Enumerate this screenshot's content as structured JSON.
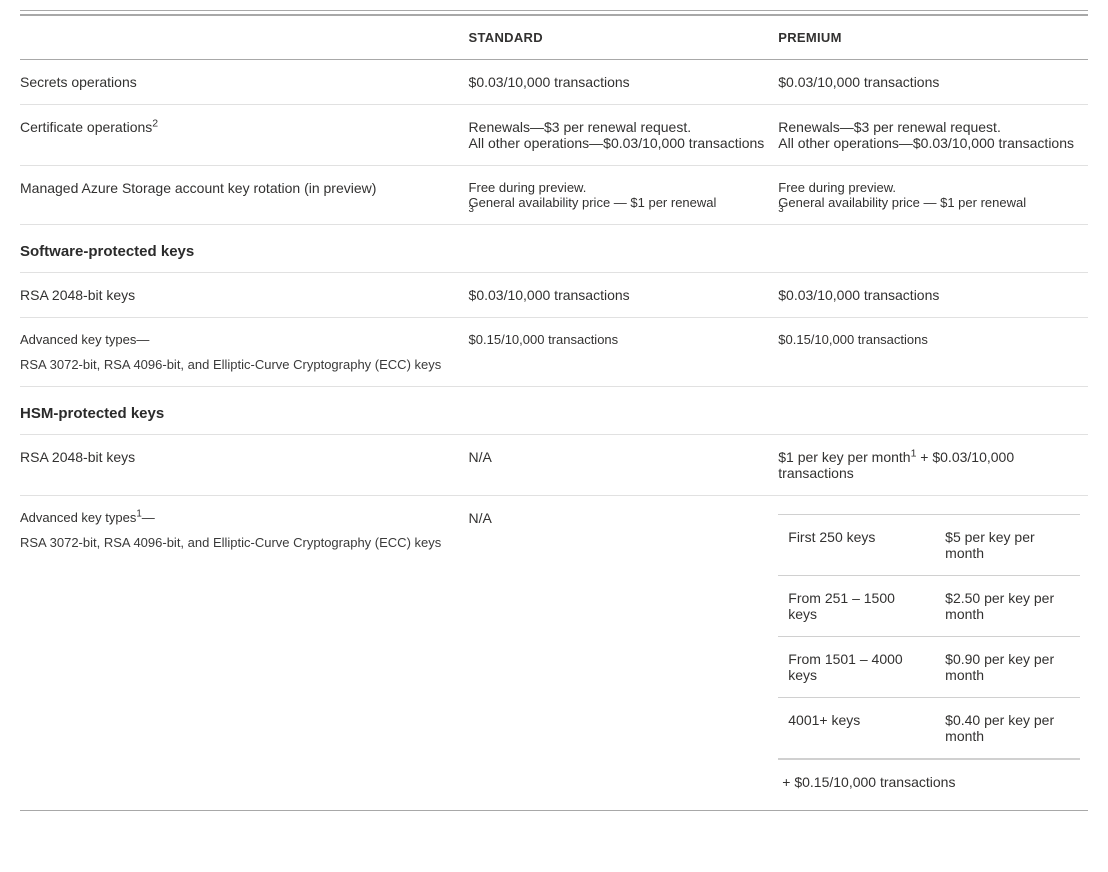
{
  "headers": {
    "feature": "",
    "standard": "STANDARD",
    "premium": "PREMIUM"
  },
  "rows": {
    "secrets": {
      "feature": "Secrets operations",
      "standard": "$0.03/10,000 transactions",
      "premium": "$0.03/10,000 transactions"
    },
    "certs": {
      "feature_main": "Certificate operations",
      "feature_sup": "2",
      "std_l1": "Renewals—$3 per renewal request.",
      "std_l2": "All other operations—$0.03/10,000 transactions",
      "prem_l1": "Renewals—$3 per renewal request.",
      "prem_l2": "All other operations—$0.03/10,000 transactions"
    },
    "storage": {
      "feature": "Managed Azure Storage account key rotation (in preview)",
      "std_l1": "Free during preview.",
      "std_l2_prefix": "General availability price — $1 per renewal",
      "std_l2_sup": "3",
      "prem_l1": "Free during preview.",
      "prem_l2_prefix": "General availability price — $1 per renewal",
      "prem_l2_sup": "3"
    }
  },
  "sections": {
    "software": "Software-protected keys",
    "hsm": "HSM-protected keys"
  },
  "software": {
    "rsa2048": {
      "feature": "RSA 2048-bit keys",
      "standard": "$0.03/10,000 transactions",
      "premium": "$0.03/10,000 transactions"
    },
    "advanced": {
      "feature_main": "Advanced key types—",
      "feature_sub": "RSA 3072-bit, RSA 4096-bit, and Elliptic-Curve Cryptography (ECC) keys",
      "standard": "$0.15/10,000 transactions",
      "premium": "$0.15/10,000 transactions"
    }
  },
  "hsm": {
    "rsa2048": {
      "feature": "RSA 2048-bit keys",
      "standard": "N/A",
      "premium_prefix": "$1 per key per month",
      "premium_sup": "1",
      "premium_suffix": " + $0.03/10,000 transactions"
    },
    "advanced": {
      "feature_main": "Advanced key types",
      "feature_sup": "1",
      "feature_dash": "—",
      "feature_sub": "RSA 3072-bit, RSA 4096-bit, and Elliptic-Curve Cryptography (ECC) keys",
      "standard": "N/A",
      "tiers": [
        {
          "range": "First 250 keys",
          "price": "$5 per key per month"
        },
        {
          "range": "From 251 – 1500 keys",
          "price": "$2.50 per key per month"
        },
        {
          "range": "From 1501 – 4000 keys",
          "price": "$0.90 per key per month"
        },
        {
          "range": "4001+ keys",
          "price": "$0.40 per key per month"
        }
      ],
      "addendum": "+ $0.15/10,000 transactions"
    }
  }
}
